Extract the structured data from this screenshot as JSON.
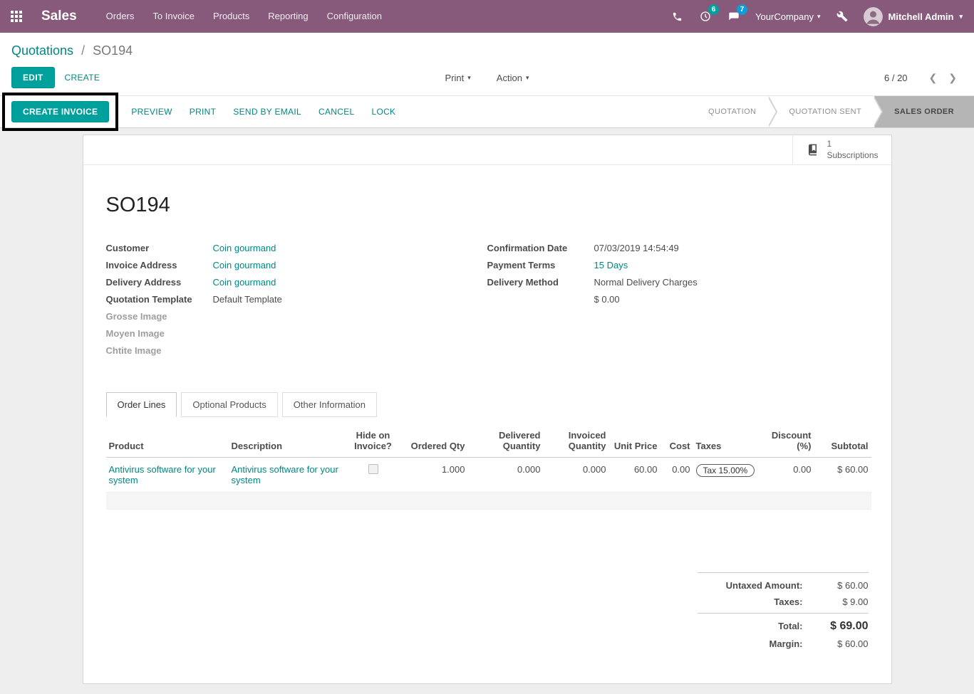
{
  "colors": {
    "navbar_bg": "#875A7B",
    "primary_button": "#00A09D",
    "link": "#008784",
    "active_state_bg": "#B5B5B5",
    "numeric_value": "#4AA0C8"
  },
  "glyphs": {
    "caret_down": "▾",
    "chevron_left": "❮",
    "chevron_right": "❯",
    "breadcrumb_separator": "/"
  },
  "navbar": {
    "app_name": "Sales",
    "menu": [
      "Orders",
      "To Invoice",
      "Products",
      "Reporting",
      "Configuration"
    ],
    "activity_badge": "6",
    "messages_badge": "7",
    "company": "YourCompany",
    "user": "Mitchell Admin"
  },
  "breadcrumb": {
    "parent": "Quotations",
    "current": "SO194"
  },
  "control_panel": {
    "edit_label": "EDIT",
    "create_label": "CREATE",
    "print_label": "Print",
    "action_label": "Action",
    "pager_text": "6 / 20"
  },
  "statusbar": {
    "create_invoice_label": "CREATE INVOICE",
    "preview_label": "PREVIEW",
    "print_label": "PRINT",
    "send_by_email_label": "SEND BY EMAIL",
    "cancel_label": "CANCEL",
    "lock_label": "LOCK",
    "states": [
      "QUOTATION",
      "QUOTATION SENT",
      "SALES ORDER"
    ],
    "active_state": "SALES ORDER"
  },
  "sheet": {
    "stat_button": {
      "value": "1",
      "label": "Subscriptions"
    },
    "title": "SO194",
    "fields_left": [
      {
        "label": "Customer",
        "value": "Coin gourmand"
      },
      {
        "label": "Invoice Address",
        "value": "Coin gourmand"
      },
      {
        "label": "Delivery Address",
        "value": "Coin gourmand"
      },
      {
        "label": "Quotation Template",
        "value": "Default Template"
      },
      {
        "label": "Grosse Image",
        "value": ""
      },
      {
        "label": "Moyen Image",
        "value": ""
      },
      {
        "label": "Chtite Image",
        "value": ""
      }
    ],
    "fields_right": [
      {
        "label": "Confirmation Date",
        "value": "07/03/2019 14:54:49"
      },
      {
        "label": "Payment Terms",
        "value": "15 Days"
      },
      {
        "label": "Delivery Method",
        "value": "Normal Delivery Charges"
      },
      {
        "label": "",
        "value": "$ 0.00"
      }
    ],
    "tabs": [
      "Order Lines",
      "Optional Products",
      "Other Information"
    ],
    "active_tab": "Order Lines"
  },
  "order_lines": {
    "headers": [
      "Product",
      "Description",
      "Hide on Invoice?",
      "Ordered Qty",
      "Delivered Quantity",
      "Invoiced Quantity",
      "Unit Price",
      "Cost",
      "Taxes",
      "Discount (%)",
      "Subtotal"
    ],
    "row": {
      "product": "Antivirus software for your system",
      "description": "Antivirus software for your system",
      "hide_on_invoice_checked": false,
      "ordered_qty": "1.000",
      "delivered_qty": "0.000",
      "invoiced_qty": "0.000",
      "unit_price": "60.00",
      "cost": "0.00",
      "taxes": "Tax 15.00%",
      "discount": "0.00",
      "subtotal": "$ 60.00"
    }
  },
  "totals": {
    "untaxed_label": "Untaxed Amount:",
    "untaxed_value": "$ 60.00",
    "taxes_label": "Taxes:",
    "taxes_value": "$ 9.00",
    "total_label": "Total:",
    "total_value": "$ 69.00",
    "margin_label": "Margin:",
    "margin_value": "$ 60.00"
  }
}
